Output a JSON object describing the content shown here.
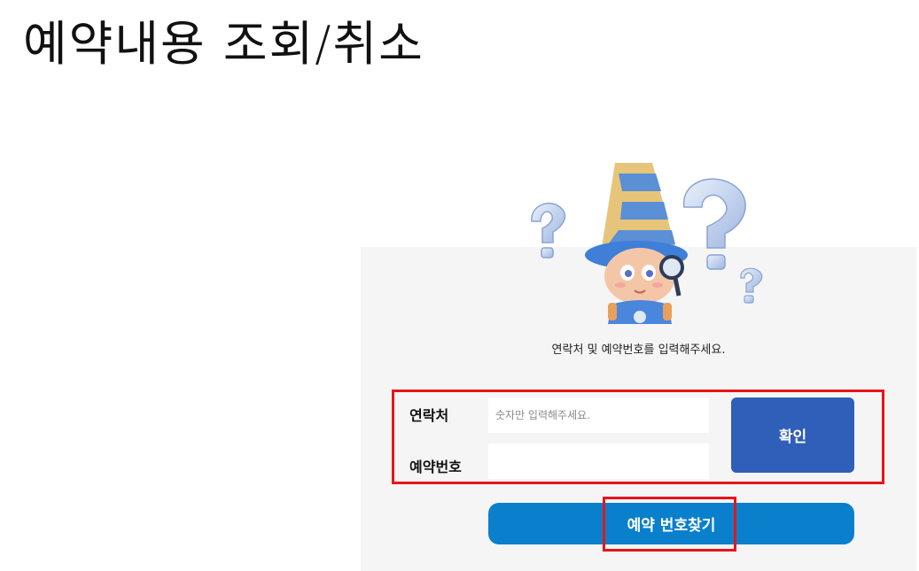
{
  "page": {
    "title": "예약내용 조회/취소"
  },
  "form": {
    "instruction": "연락처 및 예약번호를 입력해주세요.",
    "contact_label": "연락처",
    "contact_placeholder": "숫자만 입력해주세요.",
    "contact_value": "",
    "reservation_label": "예약번호",
    "reservation_value": "",
    "confirm_label": "확인",
    "find_label": "예약 번호찾기"
  },
  "colors": {
    "confirm_button": "#2f5fb8",
    "find_button": "#0a80cc",
    "highlight": "#e8141a",
    "card_background": "#f5f5f5"
  },
  "icons": {
    "mascot": "wizard-mascot-with-magnifier-and-question-marks-icon"
  }
}
